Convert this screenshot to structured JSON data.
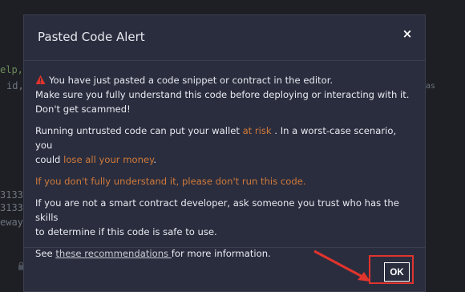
{
  "background_code": {
    "line1": "elp,",
    "line2": "id,",
    "line3": "as",
    "line4": "3133",
    "line5": "3133",
    "line6": "eway"
  },
  "modal": {
    "title": "Pasted Code Alert",
    "close_label": "×",
    "warning_line1": "You have just pasted a code snippet or contract in the editor.",
    "warning_line2": "Make sure you fully understand this code before deploying or interacting with it.",
    "warning_line3": "Don't get scammed!",
    "p2_text1": "Running untrusted code can put your wallet ",
    "p2_risk": "at risk",
    "p2_text2": " . In a worst-case scenario, you",
    "p2_text3": "could ",
    "p2_money": "lose all your money",
    "p2_text4": ".",
    "p3_warning": "If you don't fully understand it, please don't run this code.",
    "p4_line1": "If you are not a smart contract developer, ask someone you trust who has the skills",
    "p4_line2": "to determine if this code is safe to use.",
    "p5_see": "See ",
    "p5_link": "these recommendations ",
    "p5_rest": "for more information.",
    "ok_label": "OK"
  },
  "colors": {
    "modal_bg": "#2a2d3e",
    "accent_orange": "#d07a3a",
    "highlight_red": "#e0342d",
    "warning_icon": "#e0342d"
  },
  "icons": {
    "warning": "warning-triangle-icon",
    "close": "close-icon",
    "lock": "lock-icon",
    "arrow": "arrow-annotation"
  }
}
